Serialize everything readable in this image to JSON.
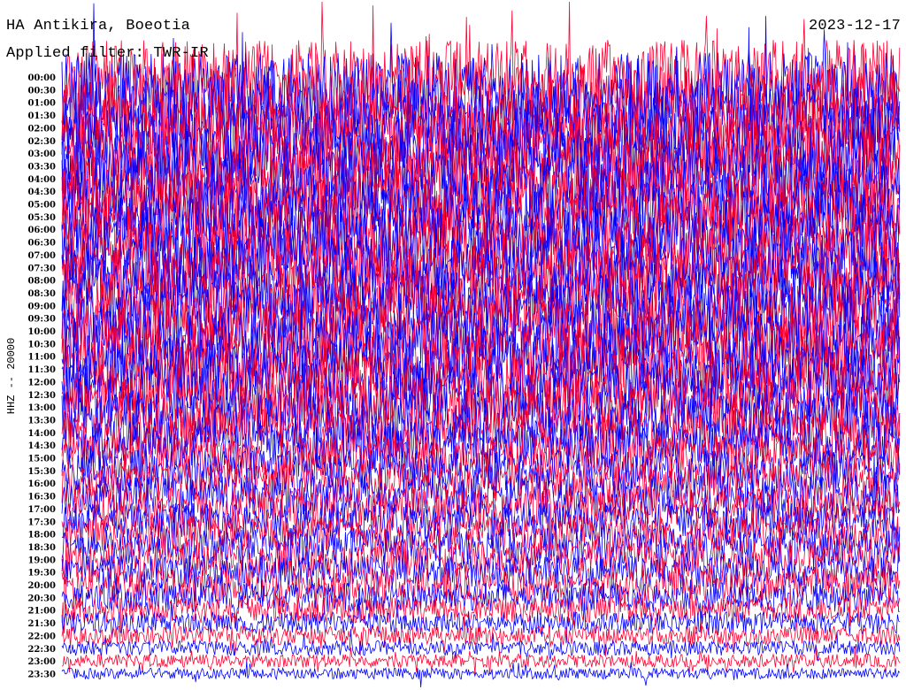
{
  "header": {
    "station": "HA Antikira, Boeotia",
    "filter": "Applied filter: TWR-IR",
    "date": "2023-12-17"
  },
  "colors": {
    "series_a": "#ff0033",
    "series_b": "#0000ff",
    "background": "#ffffff"
  },
  "chart_data": {
    "type": "line",
    "title": "HA Antikira, Boeotia",
    "ylabel": "HHZ -- 20000",
    "xlabel": "",
    "grid": false,
    "legend": "none",
    "rows": [
      "00:00",
      "00:30",
      "01:00",
      "01:30",
      "02:00",
      "02:30",
      "03:00",
      "03:30",
      "04:00",
      "04:30",
      "05:00",
      "05:30",
      "06:00",
      "06:30",
      "07:00",
      "07:30",
      "08:00",
      "08:30",
      "09:00",
      "09:30",
      "10:00",
      "10:30",
      "11:00",
      "11:30",
      "12:00",
      "12:30",
      "13:00",
      "13:30",
      "14:00",
      "14:30",
      "15:00",
      "15:30",
      "16:00",
      "16:30",
      "17:00",
      "17:30",
      "18:00",
      "18:30",
      "19:00",
      "19:30",
      "20:00",
      "20:30",
      "21:00",
      "21:30",
      "22:00",
      "22:30",
      "23:00",
      "23:30"
    ],
    "row_colors": [
      "#ff0033",
      "#0000ff"
    ],
    "row_amplitude": [
      1.0,
      1.0,
      1.0,
      1.0,
      1.0,
      1.0,
      1.0,
      1.0,
      1.0,
      1.0,
      0.95,
      0.95,
      0.95,
      0.95,
      0.9,
      0.9,
      0.9,
      0.9,
      0.9,
      0.9,
      0.9,
      0.9,
      0.9,
      0.9,
      0.85,
      0.85,
      0.8,
      0.75,
      0.7,
      0.65,
      0.6,
      0.55,
      0.55,
      0.55,
      0.55,
      0.5,
      0.5,
      0.5,
      0.5,
      0.45,
      0.45,
      0.4,
      0.35,
      0.3,
      0.25,
      0.2,
      0.18,
      0.15
    ]
  }
}
